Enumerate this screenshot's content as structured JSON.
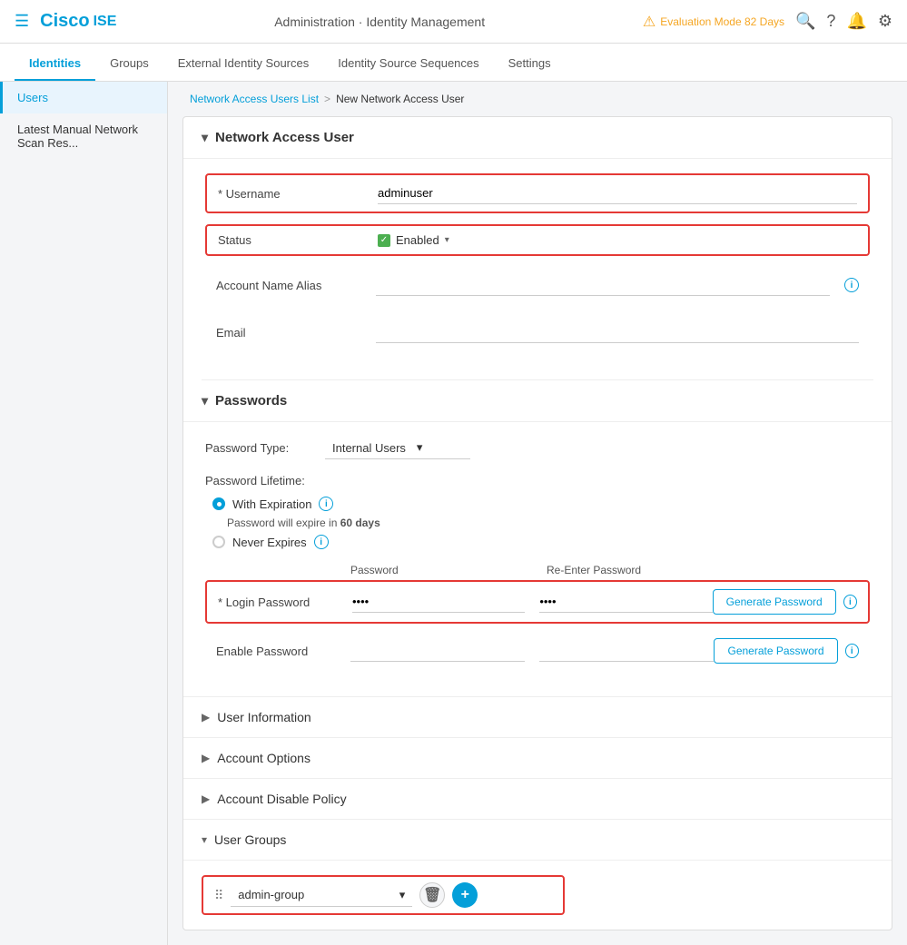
{
  "topNav": {
    "hamburger": "☰",
    "brand": "Cisco",
    "product": "ISE",
    "title": "Administration · Identity Management",
    "evalBadge": "Evaluation Mode 82 Days"
  },
  "tabs": [
    {
      "id": "identities",
      "label": "Identities",
      "active": true
    },
    {
      "id": "groups",
      "label": "Groups",
      "active": false
    },
    {
      "id": "external-identity-sources",
      "label": "External Identity Sources",
      "active": false
    },
    {
      "id": "identity-source-sequences",
      "label": "Identity Source Sequences",
      "active": false
    },
    {
      "id": "settings",
      "label": "Settings",
      "active": false
    }
  ],
  "sidebar": {
    "items": [
      {
        "id": "users",
        "label": "Users",
        "active": true
      },
      {
        "id": "latest-manual",
        "label": "Latest Manual Network Scan Res...",
        "active": false
      }
    ]
  },
  "breadcrumb": {
    "link": "Network Access Users List",
    "separator": ">",
    "current": "New Network Access User"
  },
  "networkAccessUser": {
    "sectionTitle": "Network Access User",
    "usernameLabel": "* Username",
    "usernameValue": "adminuser",
    "statusLabel": "Status",
    "statusValue": "Enabled",
    "accountNameAliasLabel": "Account Name Alias",
    "accountNameAliasPlaceholder": "",
    "emailLabel": "Email",
    "emailPlaceholder": ""
  },
  "passwords": {
    "sectionTitle": "Passwords",
    "passwordTypeLabel": "Password Type:",
    "passwordTypeValue": "Internal Users",
    "passwordLifetimeLabel": "Password Lifetime:",
    "withExpirationLabel": "With Expiration",
    "expireNotePrefix": "Password will expire in ",
    "expireDays": "60 days",
    "neverExpiresLabel": "Never Expires",
    "passwordColHeader": "Password",
    "reEnterColHeader": "Re-Enter Password",
    "loginPasswordLabel": "* Login Password",
    "loginPasswordValue": "••••",
    "loginPasswordReValue": "••••",
    "enablePasswordLabel": "Enable Password",
    "enablePasswordValue": "",
    "enablePasswordReValue": "",
    "generatePasswordLabel": "Generate Password"
  },
  "userInformation": {
    "label": "User Information"
  },
  "accountOptions": {
    "label": "Account Options"
  },
  "accountDisablePolicy": {
    "label": "Account Disable Policy"
  },
  "userGroups": {
    "sectionTitle": "User Groups",
    "groupValue": "admin-group"
  }
}
